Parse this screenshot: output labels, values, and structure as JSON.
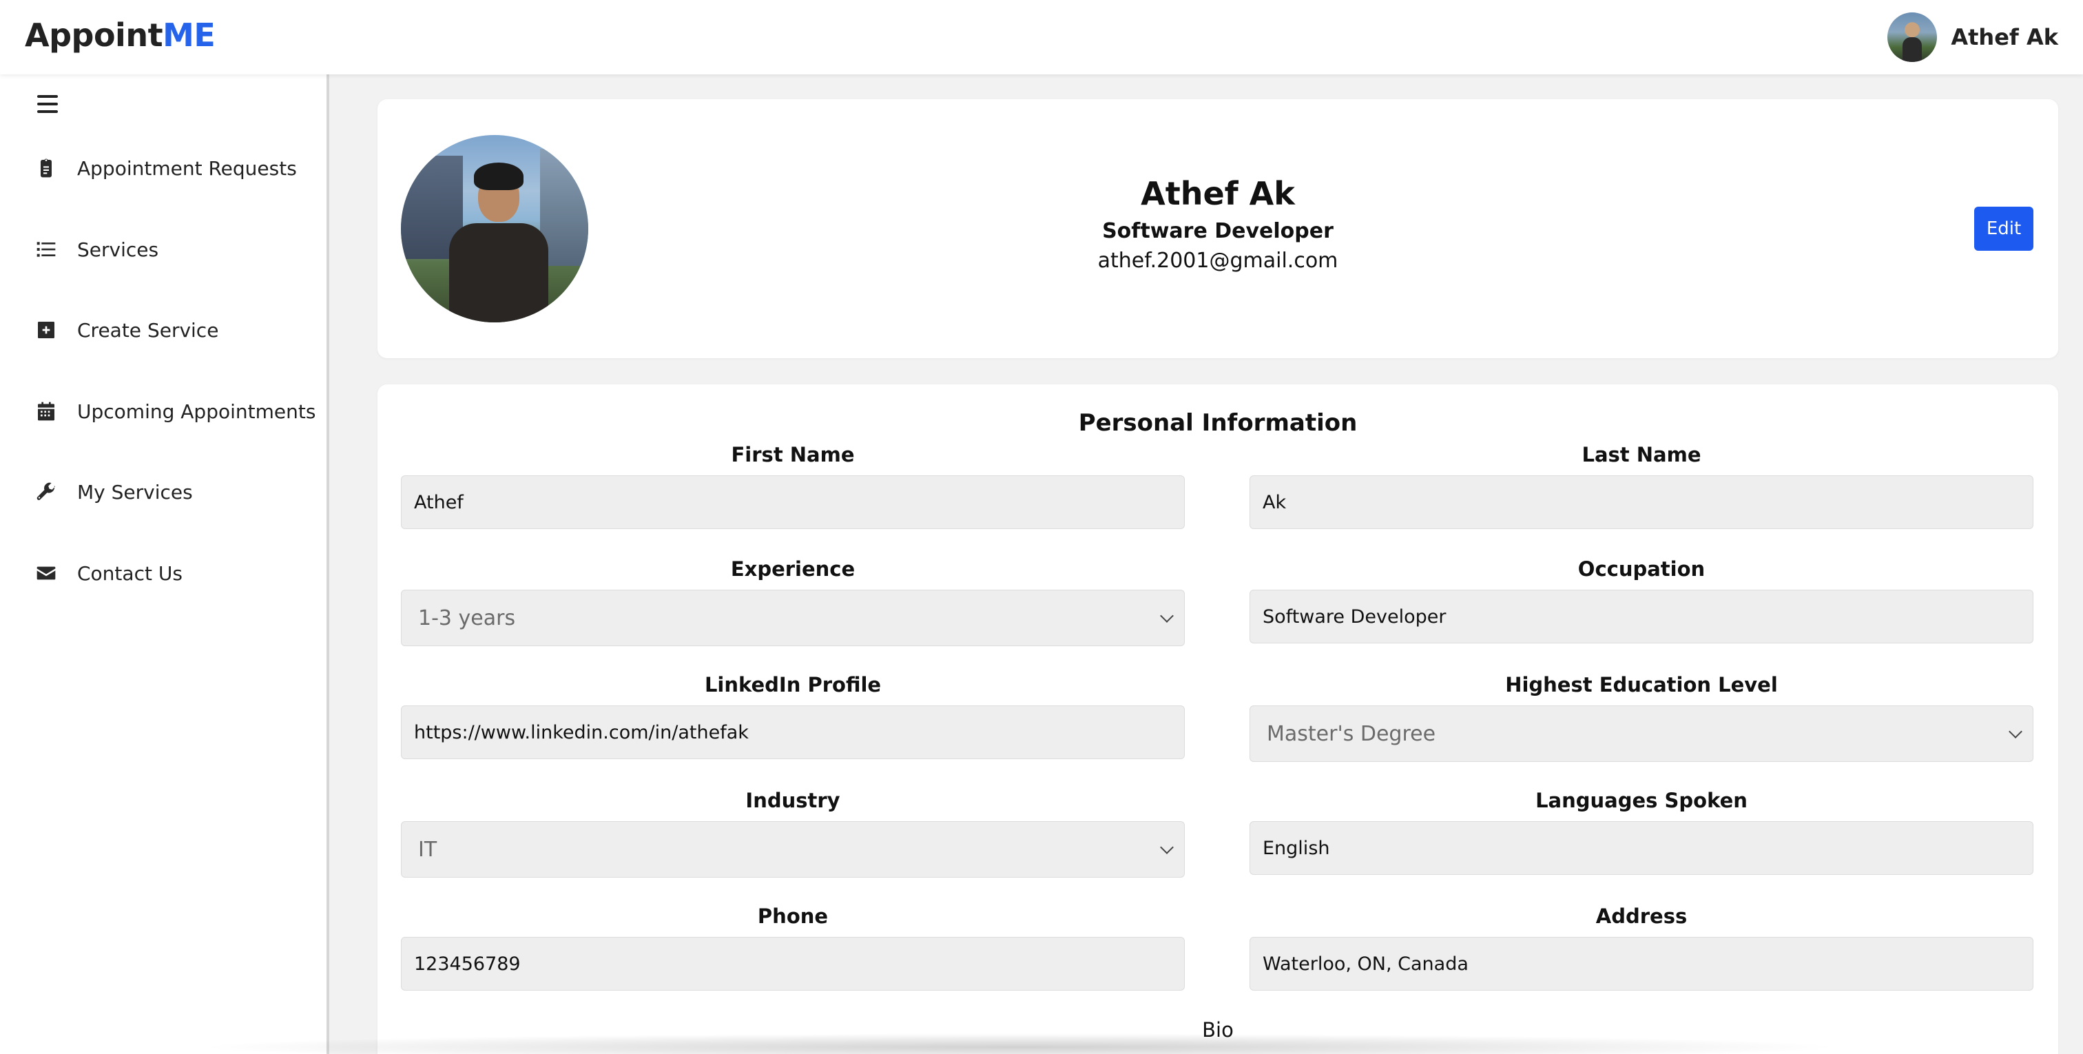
{
  "app": {
    "logo_main": "Appoint",
    "logo_accent": "ME",
    "accent_color": "#2563eb"
  },
  "header": {
    "user_name": "Athef Ak",
    "avatar_icon": "user-photo"
  },
  "sidebar": {
    "menu_icon": "hamburger-icon",
    "items": [
      {
        "label": "Appointment Requests",
        "icon": "clipboard-icon"
      },
      {
        "label": "Services",
        "icon": "list-icon"
      },
      {
        "label": "Create Service",
        "icon": "plus-square-icon"
      },
      {
        "label": "Upcoming Appointments",
        "icon": "calendar-icon"
      },
      {
        "label": "My Services",
        "icon": "wrench-icon"
      },
      {
        "label": "Contact Us",
        "icon": "envelope-icon"
      }
    ]
  },
  "profile": {
    "name": "Athef Ak",
    "occupation": "Software Developer",
    "email": "athef.2001@gmail.com",
    "edit_label": "Edit",
    "edit_color": "#1d5bf0"
  },
  "personal_info": {
    "title": "Personal Information",
    "fields": {
      "first_name": {
        "label": "First Name",
        "value": "Athef"
      },
      "last_name": {
        "label": "Last Name",
        "value": "Ak"
      },
      "experience": {
        "label": "Experience",
        "value": "1-3 years"
      },
      "occupation": {
        "label": "Occupation",
        "value": "Software Developer"
      },
      "linkedin": {
        "label": "LinkedIn Profile",
        "value": "https://www.linkedin.com/in/athefak"
      },
      "education": {
        "label": "Highest Education Level",
        "value": "Master's Degree"
      },
      "industry": {
        "label": "Industry",
        "value": "IT"
      },
      "languages": {
        "label": "Languages Spoken",
        "value": "English"
      },
      "phone": {
        "label": "Phone",
        "value": "123456789"
      },
      "address": {
        "label": "Address",
        "value": "Waterloo, ON, Canada"
      }
    },
    "bio_label": "Bio"
  }
}
